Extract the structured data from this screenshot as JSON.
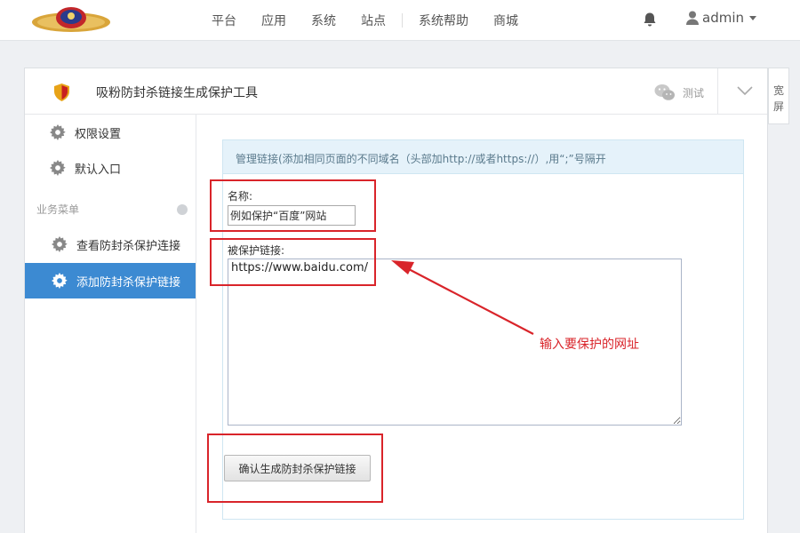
{
  "topbar": {
    "nav": [
      "平台",
      "应用",
      "系统",
      "站点",
      "系统帮助",
      "商城"
    ],
    "user": "admin",
    "icons": {
      "bell": "bell-icon",
      "user": "user-icon",
      "logo": "emblem-logo"
    }
  },
  "widetab": {
    "label": "宽屏"
  },
  "panel": {
    "title": "吸粉防封杀链接生成保护工具",
    "test_label": "测试"
  },
  "sidebar": {
    "items": [
      "权限设置",
      "默认入口"
    ],
    "section_title": "业务菜单",
    "sub_items": [
      "查看防封杀保护连接",
      "添加防封杀保护链接"
    ],
    "active_index": 1
  },
  "form": {
    "info": "管理链接(添加相同页面的不同域名（头部加http://或者https://）,用“;”号隔开",
    "name_label": "名称:",
    "name_value": "例如保护“百度”网站",
    "url_label": "被保护链接:",
    "url_value": "https://www.baidu.com/",
    "submit_label": "确认生成防封杀保护链接"
  },
  "annotation": {
    "text": "输入要保护的网址",
    "color": "#d9242a"
  },
  "colors": {
    "accent": "#3c8ad2",
    "info_bg": "#e5f2fa",
    "annotation_red": "#d9242a"
  }
}
